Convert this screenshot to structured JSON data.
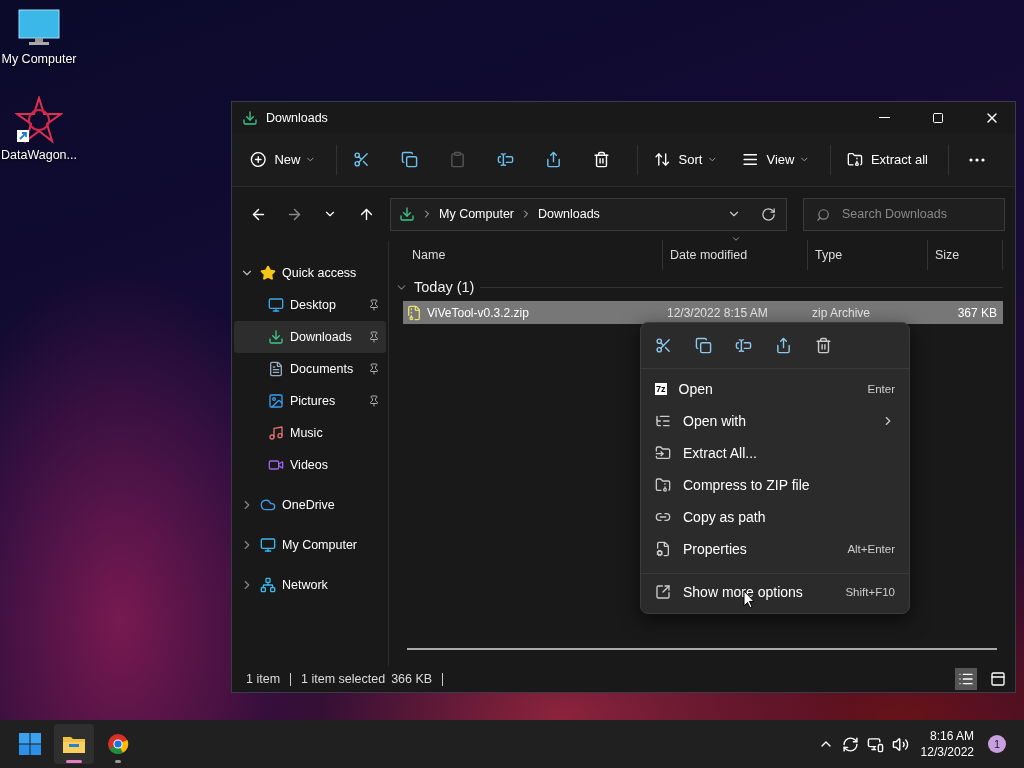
{
  "desktop_icons": [
    {
      "kind": "monitor",
      "label": "My Computer"
    },
    {
      "kind": "shortcut",
      "label": "DataWagon..."
    }
  ],
  "window": {
    "title": "Downloads"
  },
  "toolbar": [
    {
      "kind": "new",
      "label": "New",
      "disabled": false
    },
    {
      "kind": "separator"
    },
    {
      "kind": "cut",
      "disabled": false
    },
    {
      "kind": "copy",
      "disabled": false
    },
    {
      "kind": "paste",
      "disabled": true
    },
    {
      "kind": "rename",
      "disabled": false
    },
    {
      "kind": "share",
      "disabled": false
    },
    {
      "kind": "delete",
      "disabled": false
    },
    {
      "kind": "separator"
    },
    {
      "kind": "sort",
      "label": "Sort",
      "disabled": false
    },
    {
      "kind": "view",
      "label": "View",
      "disabled": false
    },
    {
      "kind": "separator"
    },
    {
      "kind": "extract",
      "label": "Extract all",
      "disabled": false
    },
    {
      "kind": "separator"
    },
    {
      "kind": "more",
      "disabled": false
    }
  ],
  "nav": [
    {
      "kind": "back",
      "disabled": false
    },
    {
      "kind": "forward",
      "disabled": true
    },
    {
      "kind": "recent",
      "disabled": false
    },
    {
      "kind": "up",
      "disabled": false
    }
  ],
  "address": {
    "crumbs": [
      "My Computer",
      "Downloads"
    ]
  },
  "search": {
    "placeholder": "Search Downloads"
  },
  "sidebar": {
    "items": [
      {
        "kind": "star",
        "label": "Quick access",
        "expanded": true,
        "selected": false,
        "children": [
          {
            "kind": "desktop",
            "label": "Desktop",
            "pinned": true,
            "selected": false
          },
          {
            "kind": "downloads",
            "label": "Downloads",
            "pinned": true,
            "selected": true
          },
          {
            "kind": "documents",
            "label": "Documents",
            "pinned": true,
            "selected": false
          },
          {
            "kind": "pictures",
            "label": "Pictures",
            "pinned": true,
            "selected": false
          },
          {
            "kind": "music",
            "label": "Music",
            "pinned": false,
            "selected": false
          },
          {
            "kind": "videos",
            "label": "Videos",
            "pinned": false,
            "selected": false
          }
        ]
      },
      {
        "kind": "cloud",
        "label": "OneDrive",
        "expanded": false,
        "selected": false
      },
      {
        "kind": "computer",
        "label": "My Computer",
        "expanded": false,
        "selected": false
      },
      {
        "kind": "network",
        "label": "Network",
        "expanded": false,
        "selected": false
      }
    ]
  },
  "columns": [
    {
      "label": "Name",
      "sorted": false
    },
    {
      "label": "Date modified",
      "sorted": true
    },
    {
      "label": "Type",
      "sorted": false
    },
    {
      "label": "Size",
      "sorted": false
    }
  ],
  "groups": [
    {
      "label": "Today (1)",
      "expanded": true,
      "rows": [
        {
          "name": "ViVeTool-v0.3.2.zip",
          "date": "12/3/2022 8:15 AM",
          "type": "zip Archive",
          "size": "367 KB",
          "selected": true
        }
      ]
    }
  ],
  "context_menu": {
    "quick_actions": [
      {
        "kind": "cut"
      },
      {
        "kind": "copy"
      },
      {
        "kind": "rename"
      },
      {
        "kind": "share"
      },
      {
        "kind": "delete"
      }
    ],
    "items": [
      {
        "kind": "7z",
        "label": "Open",
        "shortcut": "Enter",
        "submenu": false,
        "separator_before": false
      },
      {
        "kind": "openwith",
        "label": "Open with",
        "submenu": true,
        "separator_before": false
      },
      {
        "kind": "extract",
        "label": "Extract All...",
        "submenu": false,
        "separator_before": false
      },
      {
        "kind": "compress",
        "label": "Compress to ZIP file",
        "submenu": false,
        "separator_before": false
      },
      {
        "kind": "path",
        "label": "Copy as path",
        "submenu": false,
        "separator_before": false
      },
      {
        "kind": "properties",
        "label": "Properties",
        "shortcut": "Alt+Enter",
        "submenu": false,
        "separator_before": false
      },
      {
        "kind": "more",
        "label": "Show more options",
        "shortcut": "Shift+F10",
        "submenu": false,
        "separator_before": true
      }
    ]
  },
  "status_bar": {
    "count": "1 item",
    "selection": "1 item selected",
    "size": "366 KB"
  },
  "view_toggles": [
    {
      "kind": "details",
      "selected": true
    },
    {
      "kind": "tiles",
      "selected": false
    }
  ],
  "taskbar": {
    "apps": [
      {
        "kind": "start",
        "active": false
      },
      {
        "kind": "explorer",
        "active": true
      },
      {
        "kind": "browser",
        "active": false
      }
    ],
    "time": "8:16 AM",
    "date": "12/3/2022",
    "notifications": "1"
  }
}
